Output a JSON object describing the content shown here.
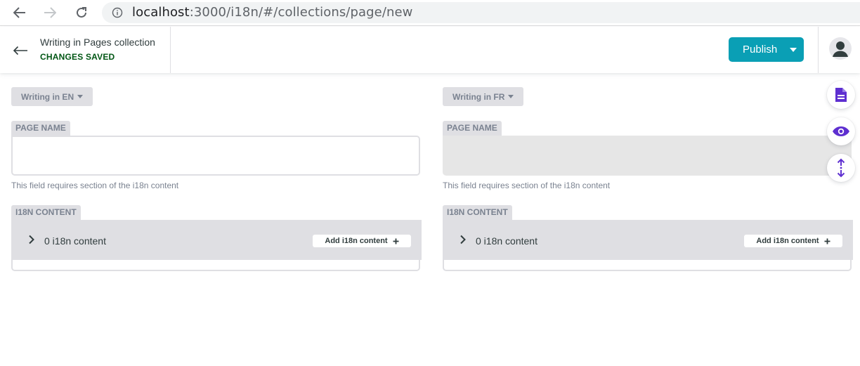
{
  "browser": {
    "url_host": "localhost",
    "url_path": ":3000/i18n/#/collections/page/new"
  },
  "header": {
    "title": "Writing in Pages collection",
    "status": "CHANGES SAVED",
    "status_color": "#005614",
    "publish_label": "Publish",
    "accent_color": "#0a9fb5"
  },
  "columns": [
    {
      "locale_label": "Writing in EN",
      "page_name_label": "PAGE NAME",
      "page_name_value": "",
      "hint": "This field requires section of the i18n content",
      "i18n_label": "I18N CONTENT",
      "i18n_count": "0 i18n content",
      "add_label": "Add i18n content"
    },
    {
      "locale_label": "Writing in FR",
      "page_name_label": "PAGE NAME",
      "page_name_value": "",
      "hint": "This field requires section of the i18n content",
      "i18n_label": "I18N CONTENT",
      "i18n_count": "0 i18n content",
      "add_label": "Add i18n content"
    }
  ],
  "side_actions": {
    "icons": [
      "document-icon",
      "eye-icon",
      "sync-scroll-icon"
    ],
    "icon_color": "#5e2fd0"
  }
}
